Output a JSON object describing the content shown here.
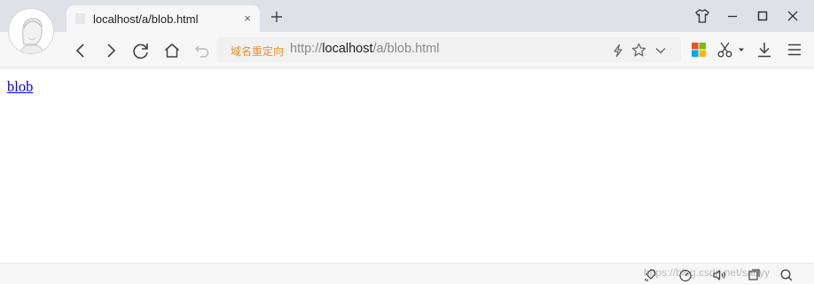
{
  "tab": {
    "title": "localhost/a/blob.html",
    "close_glyph": "×"
  },
  "address_bar": {
    "redirect_label": "域名重定向",
    "url_scheme": "http://",
    "url_host": "localhost",
    "url_path": "/a/blob.html"
  },
  "page": {
    "link_text": "blob"
  },
  "status_bar": {
    "watermark": "https://blog.csdn.net/sauyy"
  },
  "icons": {
    "avatar": "avatar-icon",
    "new_tab": "plus-icon",
    "skin": "tshirt-icon",
    "minimize": "minimize-icon",
    "maximize": "maximize-icon",
    "close": "close-icon",
    "back": "back-icon",
    "forward": "forward-icon",
    "reload": "reload-icon",
    "home": "home-icon",
    "undo": "undo-icon",
    "lightning": "lightning-icon",
    "star": "star-icon",
    "chevron": "chevron-down-icon",
    "apps": "apps-grid-icon",
    "scissors": "scissors-icon",
    "download": "download-icon",
    "menu": "menu-icon"
  },
  "colors": {
    "apps_red": "#f25022",
    "apps_green": "#7fba00",
    "apps_blue": "#00a4ef",
    "apps_yellow": "#ffb900",
    "redirect": "#e6932d",
    "link": "#0000ee"
  }
}
